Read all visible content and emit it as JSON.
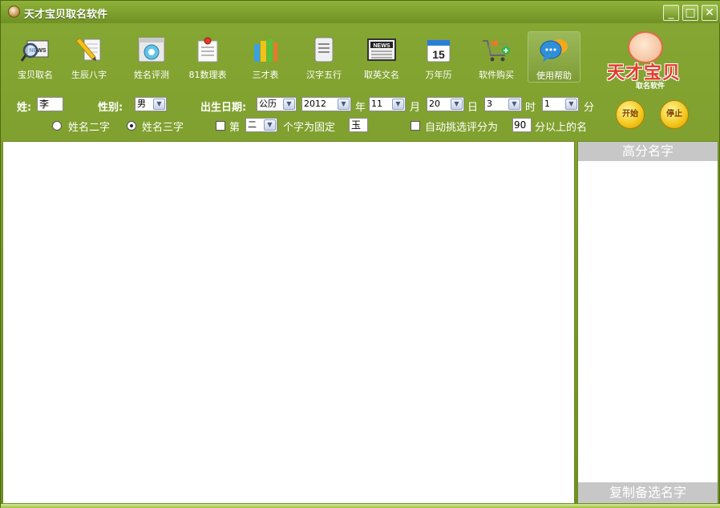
{
  "window": {
    "title": "天才宝贝取名软件",
    "buttons": {
      "minimize": "_",
      "maximize": "□",
      "close": "✕"
    }
  },
  "toolbar": {
    "items": [
      {
        "label": "宝贝取名",
        "icon": "news-search-icon"
      },
      {
        "label": "生辰八字",
        "icon": "pencil-paper-icon"
      },
      {
        "label": "姓名评测",
        "icon": "dial-window-icon"
      },
      {
        "label": "81数理表",
        "icon": "notepad-pin-icon"
      },
      {
        "label": "三才表",
        "icon": "book-stack-icon"
      },
      {
        "label": "汉字五行",
        "icon": "document-icon"
      },
      {
        "label": "取英文名",
        "icon": "newspaper-icon"
      },
      {
        "label": "万年历",
        "icon": "calendar-icon"
      },
      {
        "label": "软件购买",
        "icon": "shopping-cart-icon"
      },
      {
        "label": "使用帮助",
        "icon": "chat-bubbles-icon"
      }
    ],
    "calendar_day": "15",
    "news_text": "NEWS"
  },
  "logo": {
    "brand": "天才宝贝",
    "sub": "取名软件"
  },
  "form": {
    "surname_label": "姓:",
    "surname_value": "李",
    "gender_label": "性别:",
    "gender_value": "男",
    "birth_label": "出生日期:",
    "calendar_type": "公历",
    "year_value": "2012",
    "year_unit": "年",
    "month_value": "11",
    "month_unit": "月",
    "day_value": "20",
    "day_unit": "日",
    "hour_value": "3",
    "hour_unit": "时",
    "minute_value": "1",
    "minute_unit": "分",
    "two_char_label": "姓名二字",
    "three_char_label": "姓名三字",
    "fixed_prefix": "第",
    "fixed_position": "二",
    "fixed_suffix": "个字为固定",
    "fixed_char": "玉",
    "auto_label": "自动挑选评分为",
    "auto_score": "90",
    "auto_suffix": "分以上的名"
  },
  "actions": {
    "start": "开始",
    "stop": "停止"
  },
  "side": {
    "header": "高分名字",
    "footer": "复制备选名字"
  }
}
